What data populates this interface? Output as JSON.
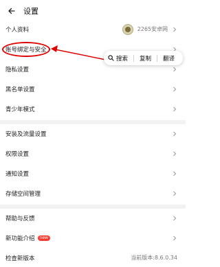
{
  "header": {
    "title": "设置"
  },
  "rows": [
    {
      "label": "个人资料",
      "right_text": "2265安卓网"
    },
    {
      "label": "账号绑定与安全"
    },
    {
      "label": "隐私设置"
    },
    {
      "label": "黑名单设置"
    },
    {
      "label": "青少年模式"
    },
    {
      "label": "安装及流量设置"
    },
    {
      "label": "权限设置"
    },
    {
      "label": "通知设置"
    },
    {
      "label": "存储空间管理"
    },
    {
      "label": "帮助与反馈"
    },
    {
      "label": "新功能介绍",
      "badge": "new"
    },
    {
      "label": "检查新版本",
      "right_text": "当前版本:8.6.0.34"
    }
  ],
  "context_menu": {
    "search": "搜索",
    "copy": "复制",
    "translate": "翻译"
  },
  "colors": {
    "annotation_red": "#e00000",
    "badge_red": "#ff3b30"
  }
}
